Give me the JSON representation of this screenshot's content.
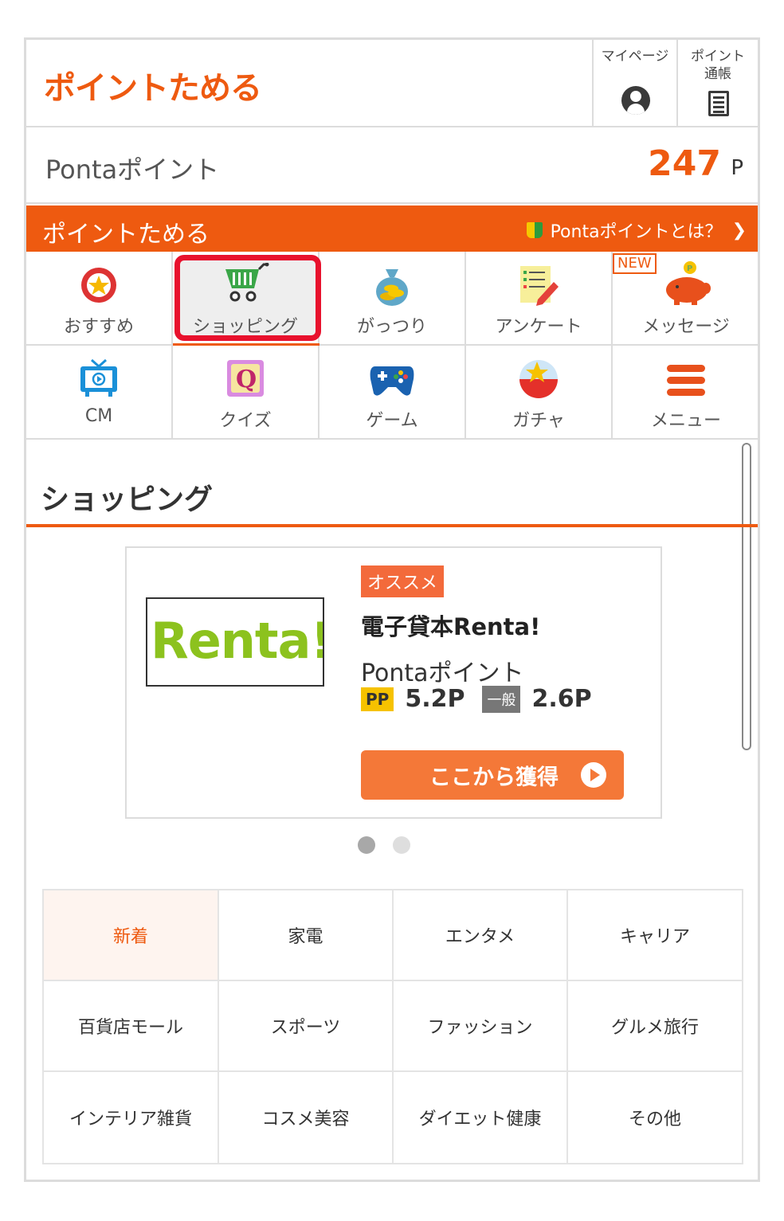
{
  "header": {
    "logo": "ポイントためる",
    "mypage_label": "マイページ",
    "passbook_label": "ポイント\n通帳"
  },
  "ponta": {
    "label": "Pontaポイント",
    "value": "247",
    "unit": "P"
  },
  "section_bar": {
    "title": "ポイントためる",
    "link": "Pontaポイントとは？"
  },
  "nav": {
    "items": [
      {
        "label": "おすすめ",
        "icon": "laurel-star-icon"
      },
      {
        "label": "ショッピング",
        "icon": "shopping-cart-icon",
        "active": true
      },
      {
        "label": "がっつり",
        "icon": "money-bag-icon"
      },
      {
        "label": "アンケート",
        "icon": "survey-icon"
      },
      {
        "label": "メッセージ",
        "icon": "piggy-bank-icon",
        "badge": "NEW"
      },
      {
        "label": "CM",
        "icon": "tv-icon"
      },
      {
        "label": "クイズ",
        "icon": "quiz-icon"
      },
      {
        "label": "ゲーム",
        "icon": "gamepad-icon"
      },
      {
        "label": "ガチャ",
        "icon": "gacha-capsule-icon"
      },
      {
        "label": "メニュー",
        "icon": "hamburger-menu-icon"
      }
    ]
  },
  "shopping": {
    "title": "ショッピング",
    "card": {
      "logo_text": "Renta!",
      "badge": "オススメ",
      "service_name": "電子貸本Renta!",
      "ponta_label": "Pontaポイント",
      "pp_badge": "PP",
      "pp_value": "5.2P",
      "general_badge": "一般",
      "general_value": "2.6P",
      "button_label": "ここから獲得"
    }
  },
  "categories": [
    "新着",
    "家電",
    "エンタメ",
    "キャリア",
    "百貨店モール",
    "スポーツ",
    "ファッション",
    "グルメ旅行",
    "インテリア雑貨",
    "コスメ美容",
    "ダイエット健康",
    "その他"
  ],
  "colors": {
    "brand_orange": "#ee5a10",
    "active_highlight": "#e8112d",
    "pp_yellow": "#f6c200"
  }
}
